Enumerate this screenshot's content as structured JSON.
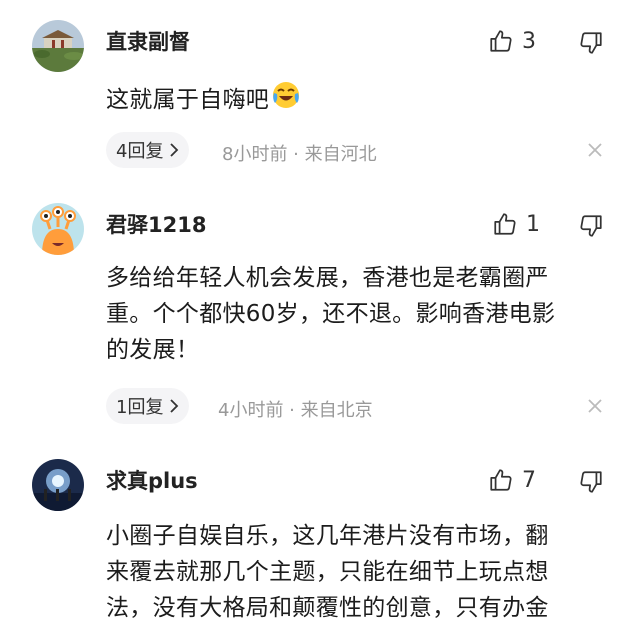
{
  "comments": [
    {
      "username": "直隶副督",
      "likes": "3",
      "text": "这就属于自嗨吧",
      "emoji": "crying-laughing-emoji",
      "reply_label": "4回复",
      "meta": "8小时前 · 来自河北"
    },
    {
      "username": "君驿1218",
      "likes": "1",
      "text_lines": [
        "多给给年轻人机会发展，香港也是老霸圈严",
        "重。个个都快60岁，还不退。影响香港电影",
        "的发展！"
      ],
      "reply_label": "1回复",
      "meta": "4小时前 · 来自北京"
    },
    {
      "username": "求真plus",
      "likes": "7",
      "text_lines": [
        "小圈子自娱自乐，这几年港片没有市场，翻",
        "来覆去就那几个主题，只能在细节上玩点想",
        "法，没有大格局和颠覆性的创意，只有办金"
      ]
    }
  ],
  "icons": {
    "like": "thumbs-up-icon",
    "dislike": "thumbs-down-icon",
    "chevron": "chevron-right-icon",
    "close": "close-icon"
  },
  "colors": {
    "meta_gray": "#999999",
    "reply_bg": "#f4f4f6"
  }
}
